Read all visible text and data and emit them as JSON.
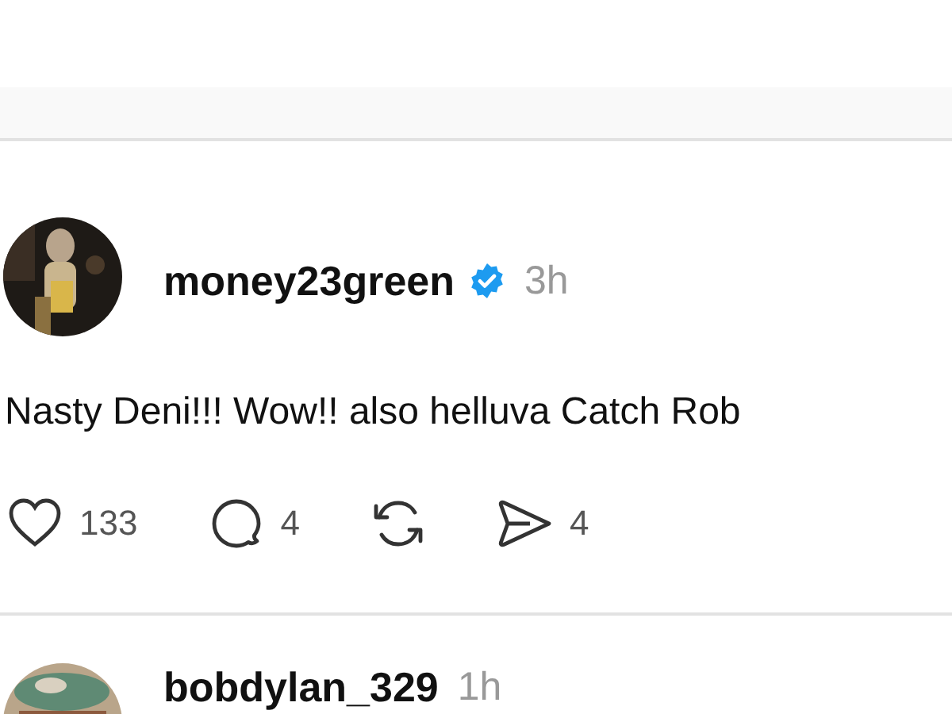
{
  "posts": [
    {
      "username": "money23green",
      "verified": true,
      "time": "3h",
      "text": "Nasty Deni!!! Wow!! also helluva Catch Rob",
      "likes": "133",
      "replies": "4",
      "shares": "4"
    },
    {
      "username": "bobdylan_329",
      "verified": false,
      "time": "1h"
    }
  ]
}
